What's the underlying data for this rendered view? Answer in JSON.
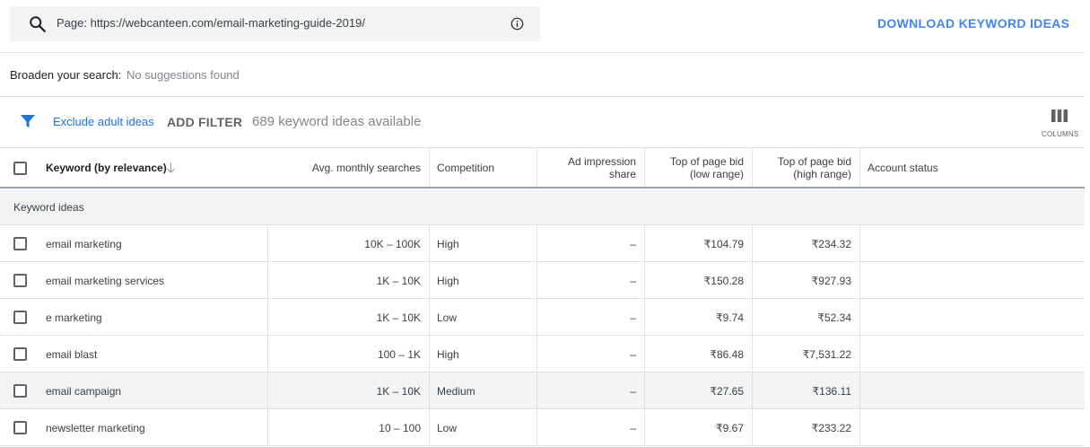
{
  "search": {
    "text": "Page: https://webcanteen.com/email-marketing-guide-2019/"
  },
  "download_label": "DOWNLOAD KEYWORD IDEAS",
  "broaden": {
    "label": "Broaden your search:",
    "value": "No suggestions found"
  },
  "filters": {
    "exclude_adult": "Exclude adult ideas",
    "add_filter": "ADD FILTER",
    "count": "689 keyword ideas available",
    "columns_label": "COLUMNS"
  },
  "table": {
    "headers": {
      "keyword": "Keyword (by relevance)",
      "avg": "Avg. monthly searches",
      "competition": "Competition",
      "ad_line1": "Ad impression",
      "ad_line2": "share",
      "low_line1": "Top of page bid",
      "low_line2": "(low range)",
      "high_line1": "Top of page bid",
      "high_line2": "(high range)",
      "account": "Account status"
    },
    "group_label": "Keyword ideas",
    "rows": [
      {
        "keyword": "email marketing",
        "avg": "10K – 100K",
        "competition": "High",
        "ad_share": "–",
        "low_bid": "₹104.79",
        "high_bid": "₹234.32",
        "account": ""
      },
      {
        "keyword": "email marketing services",
        "avg": "1K – 10K",
        "competition": "High",
        "ad_share": "–",
        "low_bid": "₹150.28",
        "high_bid": "₹927.93",
        "account": ""
      },
      {
        "keyword": "e marketing",
        "avg": "1K – 10K",
        "competition": "Low",
        "ad_share": "–",
        "low_bid": "₹9.74",
        "high_bid": "₹52.34",
        "account": ""
      },
      {
        "keyword": "email blast",
        "avg": "100 – 1K",
        "competition": "High",
        "ad_share": "–",
        "low_bid": "₹86.48",
        "high_bid": "₹7,531.22",
        "account": ""
      },
      {
        "keyword": "email campaign",
        "avg": "1K – 10K",
        "competition": "Medium",
        "ad_share": "–",
        "low_bid": "₹27.65",
        "high_bid": "₹136.11",
        "account": ""
      },
      {
        "keyword": "newsletter marketing",
        "avg": "10 – 100",
        "competition": "Low",
        "ad_share": "–",
        "low_bid": "₹9.67",
        "high_bid": "₹233.22",
        "account": ""
      }
    ]
  },
  "colors": {
    "accent": "#4285f4",
    "link": "#1a73e8",
    "highlight_row": "#f1f3f4"
  }
}
